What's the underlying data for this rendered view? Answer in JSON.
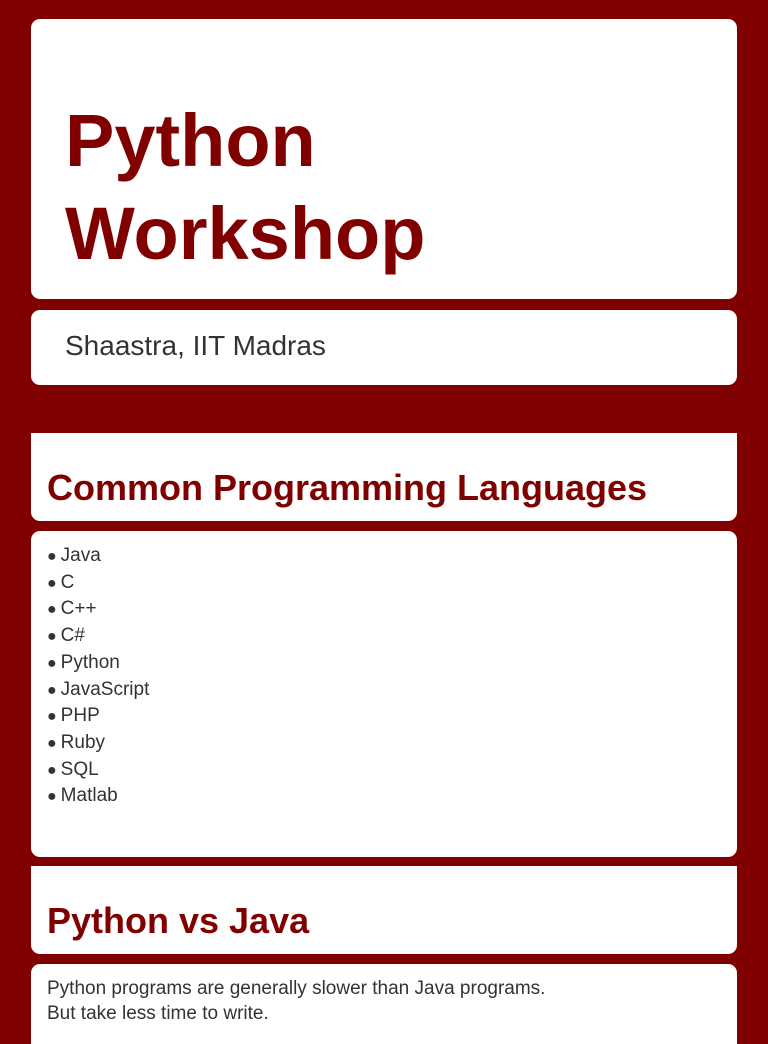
{
  "slide1": {
    "title_line1": "Python",
    "title_line2": "Workshop",
    "subtitle": "Shaastra, IIT Madras"
  },
  "slide2": {
    "title": "Common Programming Languages",
    "bullet": "●",
    "items": [
      "Java",
      "C",
      "C++",
      "C#",
      "Python",
      "JavaScript",
      "PHP",
      "Ruby",
      "SQL",
      "Matlab"
    ]
  },
  "slide3": {
    "title": "Python vs Java",
    "lines": [
      "Python programs are generally slower than Java programs.",
      "But take less time to write."
    ]
  },
  "colors": {
    "accent": "#800000",
    "text": "#333333"
  }
}
